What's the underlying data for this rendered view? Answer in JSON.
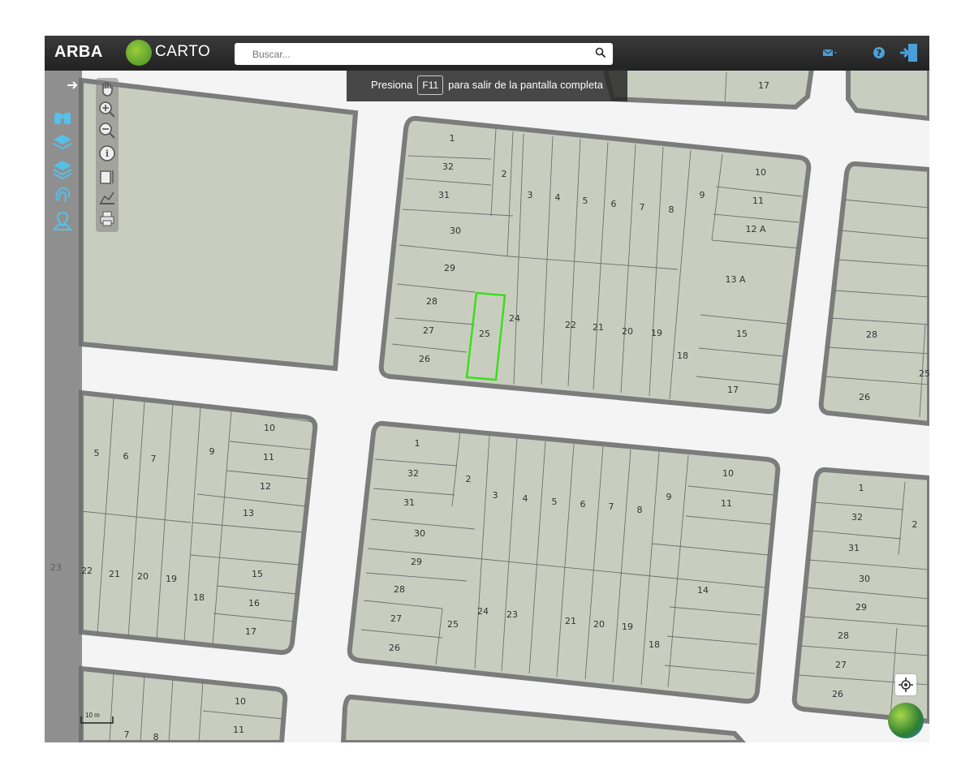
{
  "topbar": {
    "brand": "ARBA",
    "carto": "CARTO",
    "search_placeholder": "Buscar..."
  },
  "fullscreen_msg": {
    "pre": "Presiona",
    "key": "F11",
    "post": "para salir de la pantalla completa"
  },
  "scale": {
    "value": "10 m"
  },
  "colors": {
    "parcel_fill": "#c9cdbf",
    "block_outline": "#7c7c7c",
    "highlight": "#3adf1a",
    "street": "#f4f4f4"
  },
  "map_labels": {
    "b1": [
      "17"
    ],
    "b2": [
      "1",
      "32",
      "2",
      "31",
      "3",
      "4",
      "5",
      "6",
      "7",
      "8",
      "9",
      "10",
      "11",
      "12 A",
      "30",
      "29",
      "13 A",
      "28",
      "24",
      "27",
      "25",
      "22",
      "21",
      "20",
      "19",
      "15",
      "26",
      "18",
      "17"
    ],
    "b3": [
      "25",
      "28",
      "26"
    ],
    "b4": [
      "10",
      "5",
      "6",
      "7",
      "9",
      "11",
      "12",
      "13",
      "22",
      "21",
      "20",
      "19",
      "18",
      "15",
      "16",
      "17"
    ],
    "b5": [
      "1",
      "32",
      "2",
      "31",
      "3",
      "4",
      "5",
      "6",
      "7",
      "8",
      "9",
      "10",
      "11",
      "30",
      "29",
      "28",
      "14",
      "27",
      "25",
      "24",
      "23",
      "21",
      "20",
      "19",
      "18",
      "26"
    ],
    "b6": [
      "1",
      "32",
      "2",
      "31",
      "30",
      "29",
      "28",
      "27",
      "26"
    ],
    "b7": [
      "10",
      "11",
      "7",
      "8"
    ],
    "side": [
      "23"
    ]
  },
  "icons": {
    "left_panel": [
      "arrow-right-icon",
      "binoculars-icon",
      "layers-icon",
      "layers-alt-icon",
      "fingerprint-icon",
      "map-pin-icon"
    ],
    "tools": [
      "hand-icon",
      "zoom-in-icon",
      "zoom-out-icon",
      "info-icon",
      "measure-icon",
      "profile-icon",
      "print-icon"
    ]
  }
}
